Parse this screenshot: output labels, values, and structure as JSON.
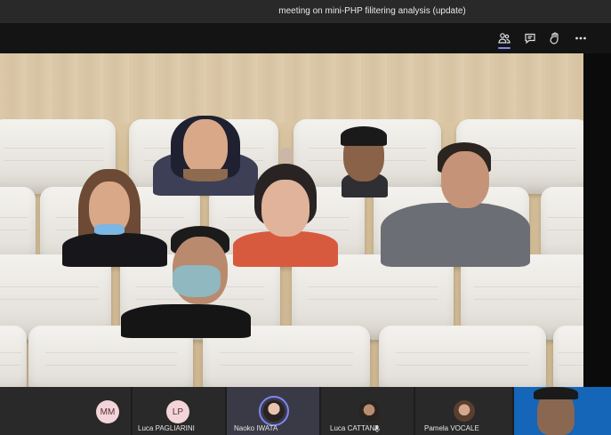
{
  "window": {
    "title": "meeting on mini-PHP filitering analysis (update)"
  },
  "toolbar": {
    "buttons": [
      {
        "icon": "people-icon",
        "active": true
      },
      {
        "icon": "chat-icon",
        "active": false
      },
      {
        "icon": "raise-hand-icon",
        "active": false
      },
      {
        "icon": "more-options-icon",
        "active": false
      }
    ]
  },
  "participants": [
    {
      "initials": "MM",
      "name": ""
    },
    {
      "initials": "LP",
      "name": "Luca PAGLIARINI"
    },
    {
      "initials": "",
      "name": "Naoko IWATA"
    },
    {
      "initials": "",
      "name": "Luca CATTANI"
    },
    {
      "initials": "",
      "name": "Pamela VOCALE"
    }
  ],
  "colors": {
    "accent": "#7f85f5",
    "avatar_bg": "#f3d5d9",
    "self_view_bg": "#1565b8"
  }
}
